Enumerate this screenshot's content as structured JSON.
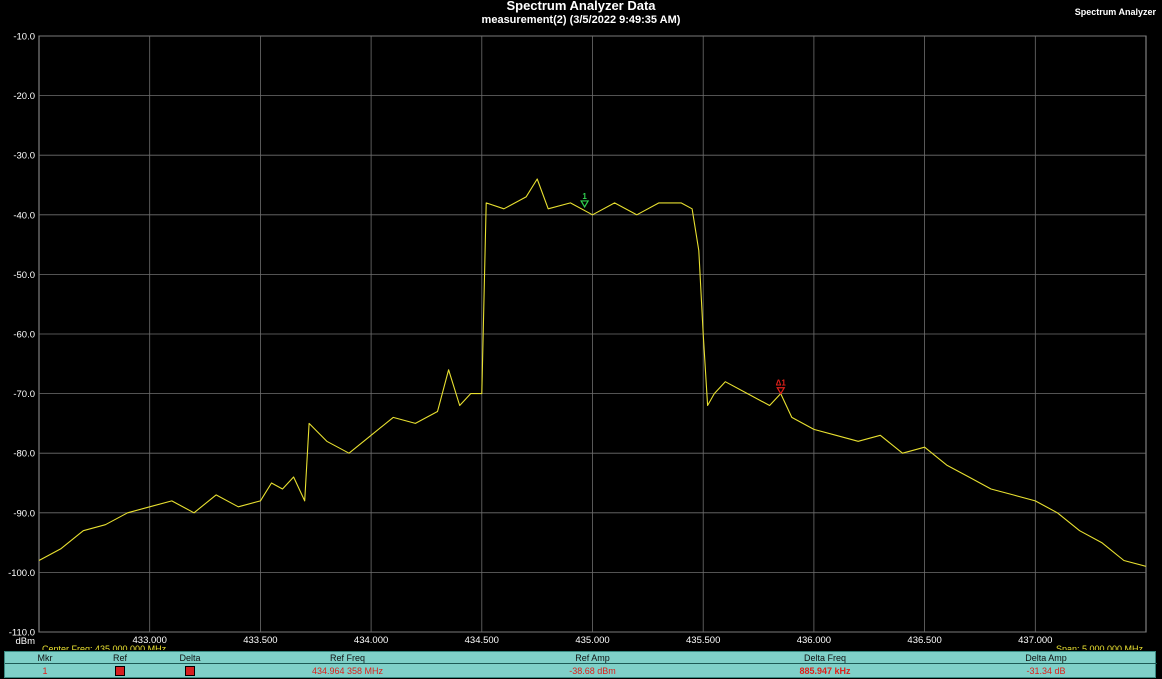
{
  "header": {
    "title": "Spectrum Analyzer Data",
    "subtitle": "measurement(2) (3/5/2022 9:49:35 AM)",
    "app_label": "Spectrum Analyzer"
  },
  "chart_data": {
    "type": "line",
    "title": "Spectrum Analyzer Data",
    "subtitle": "measurement(2) (3/5/2022 9:49:35 AM)",
    "ylabel": "dBm",
    "xlabel": "",
    "xlim": [
      432.5,
      437.5
    ],
    "ylim": [
      -110,
      -10
    ],
    "x_ticks": [
      "433.000",
      "433.500",
      "434.000",
      "434.500",
      "435.000",
      "435.500",
      "436.000",
      "436.500",
      "437.000"
    ],
    "y_ticks": [
      "-10.0",
      "-20.0",
      "-30.0",
      "-40.0",
      "-50.0",
      "-60.0",
      "-70.0",
      "-80.0",
      "-90.0",
      "-100.0",
      "-110.0"
    ],
    "grid": true,
    "trace_color": "#e8e030",
    "series": [
      {
        "x": [
          432.5,
          432.6,
          432.7,
          432.8,
          432.9,
          433.0,
          433.1,
          433.2,
          433.3,
          433.4,
          433.5,
          433.55,
          433.6,
          433.65,
          433.7,
          433.72,
          433.8,
          433.9,
          434.0,
          434.1,
          434.2,
          434.3,
          434.35,
          434.4,
          434.45,
          434.5,
          434.52,
          434.6,
          434.7,
          434.75,
          434.8,
          434.9,
          435.0,
          435.1,
          435.2,
          435.3,
          435.4,
          435.45,
          435.48,
          435.5,
          435.52,
          435.55,
          435.6,
          435.7,
          435.8,
          435.85,
          435.9,
          436.0,
          436.1,
          436.2,
          436.3,
          436.4,
          436.5,
          436.6,
          436.7,
          436.8,
          436.9,
          437.0,
          437.1,
          437.2,
          437.3,
          437.4,
          437.5
        ],
        "y": [
          -98,
          -96,
          -93,
          -92,
          -90,
          -89,
          -88,
          -90,
          -87,
          -89,
          -88,
          -85,
          -86,
          -84,
          -88,
          -75,
          -78,
          -80,
          -77,
          -74,
          -75,
          -73,
          -66,
          -72,
          -70,
          -70,
          -38,
          -39,
          -37,
          -34,
          -39,
          -38,
          -40,
          -38,
          -40,
          -38,
          -38,
          -39,
          -46,
          -60,
          -72,
          -70,
          -68,
          -70,
          -72,
          -70,
          -74,
          -76,
          -77,
          -78,
          -77,
          -80,
          -79,
          -82,
          -84,
          -86,
          -87,
          -88,
          -90,
          -93,
          -95,
          -98,
          -99
        ]
      }
    ],
    "markers": [
      {
        "label": "1",
        "freq_mhz": 434.964358,
        "amp_dbm": -38.68,
        "color": "#30d050"
      },
      {
        "label": "Δ1",
        "freq_mhz": 435.850305,
        "amp_dbm": -70.02,
        "color": "#e0201a"
      }
    ],
    "footer_left": "Center Freq: 435.000 000 MHz",
    "footer_right": "Span: 5.000 000 MHz"
  },
  "marker_table": {
    "headers": [
      "Mkr",
      "Ref",
      "Delta",
      "Ref Freq",
      "Ref Amp",
      "Delta Freq",
      "Delta Amp"
    ],
    "rows": [
      {
        "mkr": "1",
        "ref_freq": "434.964 358 MHz",
        "ref_amp": "-38.68 dBm",
        "delta_freq": "885.947 kHz",
        "delta_amp": "-31.34 dB"
      }
    ]
  }
}
